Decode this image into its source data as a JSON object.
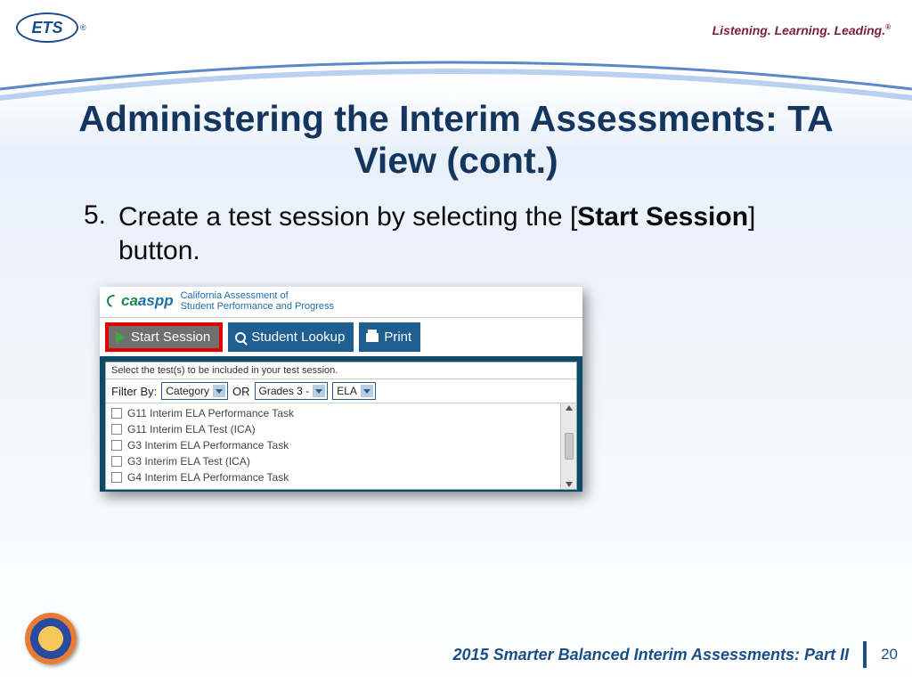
{
  "header": {
    "ets_label": "ETS",
    "tagline": "Listening. Learning. Leading."
  },
  "title": "Administering the Interim Assessments: TA View (cont.)",
  "body": {
    "number": "5.",
    "text_pre": "Create a test session by selecting the [",
    "text_bold": "Start Session",
    "text_post": "] button."
  },
  "app": {
    "logo_ca": "ca",
    "logo_aspp": "aspp",
    "subtitle_l1": "California Assessment of",
    "subtitle_l2": "Student Performance and Progress",
    "toolbar": {
      "start": "Start Session",
      "lookup": "Student Lookup",
      "print": "Print"
    },
    "panel": {
      "instruction": "Select the test(s) to be included in your test session.",
      "filter_label": "Filter By:",
      "filter_or": "OR",
      "select_category": "Category",
      "select_grades": "Grades 3 -",
      "select_subject": "ELA",
      "tests": [
        "G11 Interim ELA Performance Task",
        "G11 Interim ELA Test (ICA)",
        "G3 Interim ELA Performance Task",
        "G3 Interim ELA Test (ICA)",
        "G4 Interim ELA Performance Task"
      ]
    }
  },
  "footer": {
    "title": "2015 Smarter Balanced Interim Assessments: Part II",
    "page": "20"
  }
}
